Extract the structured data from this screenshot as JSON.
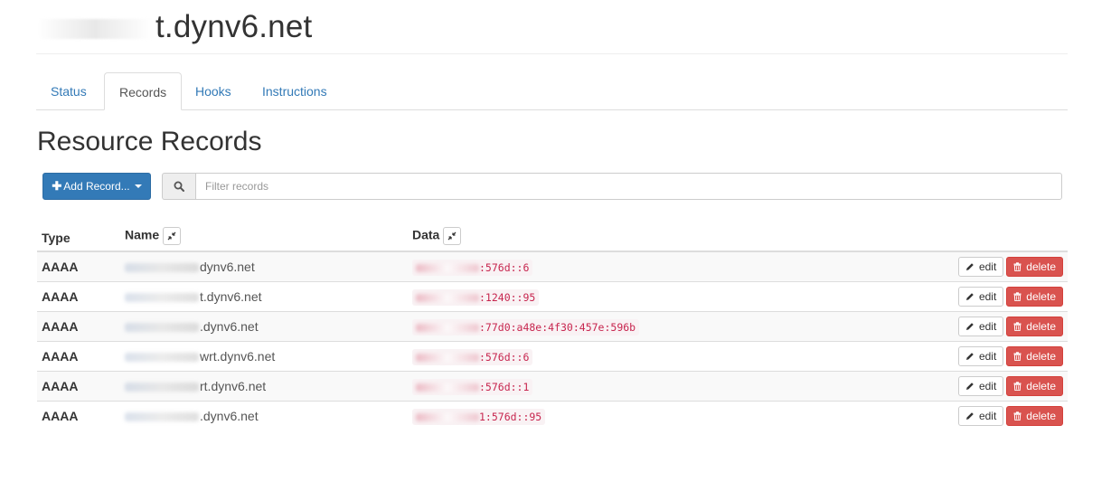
{
  "header": {
    "title_visible": "t.dynv6.net"
  },
  "tabs": [
    {
      "label": "Status",
      "active": false
    },
    {
      "label": "Records",
      "active": true
    },
    {
      "label": "Hooks",
      "active": false
    },
    {
      "label": "Instructions",
      "active": false
    }
  ],
  "section": {
    "title": "Resource Records"
  },
  "toolbar": {
    "add_label": "Add Record...",
    "add_icon": "plus-icon",
    "filter_icon": "search-icon",
    "filter_placeholder": "Filter records"
  },
  "table": {
    "columns": [
      "Type",
      "Name",
      "Data"
    ],
    "collapse_icon": "compress-icon",
    "rows": [
      {
        "type": "AAAA",
        "name_visible": "dynv6.net",
        "data_visible": ":576d::6"
      },
      {
        "type": "AAAA",
        "name_visible": "t.dynv6.net",
        "data_visible": ":1240::95"
      },
      {
        "type": "AAAA",
        "name_visible": ".dynv6.net",
        "data_visible": ":77d0:a48e:4f30:457e:596b"
      },
      {
        "type": "AAAA",
        "name_visible": "wrt.dynv6.net",
        "data_visible": ":576d::6"
      },
      {
        "type": "AAAA",
        "name_visible": "rt.dynv6.net",
        "data_visible": ":576d::1"
      },
      {
        "type": "AAAA",
        "name_visible": ".dynv6.net",
        "data_visible": "1:576d::95"
      }
    ],
    "edit_label": "edit",
    "delete_label": "delete",
    "edit_icon": "pencil-icon",
    "delete_icon": "trash-icon"
  },
  "colors": {
    "link": "#337ab7",
    "primary": "#337ab7",
    "danger": "#d9534f",
    "code_text": "#c7254e",
    "code_bg": "#f9f2f4"
  }
}
